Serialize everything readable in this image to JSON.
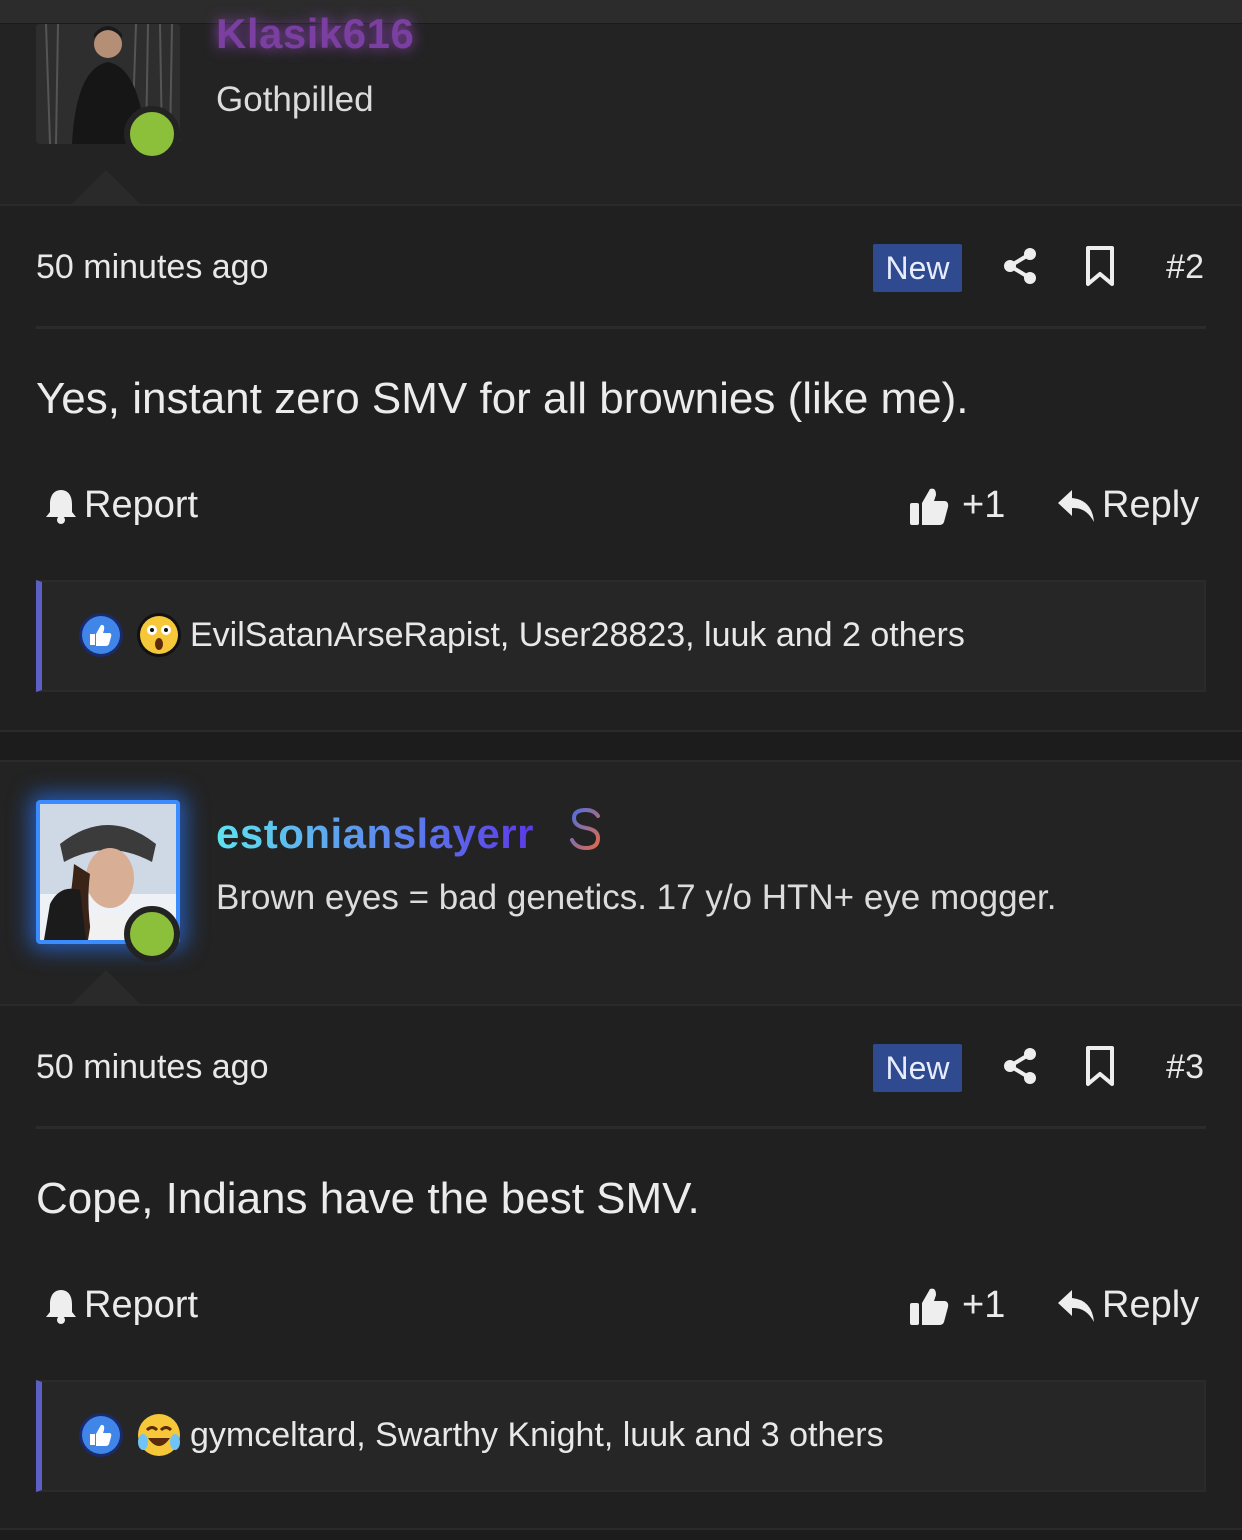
{
  "posts": [
    {
      "username": "Klasik616",
      "user_title": "Gothpilled",
      "username_color": "#7a3fa0",
      "time": "50 minutes ago",
      "badge": "New",
      "post_number": "#2",
      "message": "Yes, instant zero SMV for all brownies (like me).",
      "report_label": "Report",
      "like_count": "+1",
      "reply_label": "Reply",
      "reactions": [
        "thumbs-up-reaction",
        "shocked-face-reaction"
      ],
      "reaction_text": "EvilSatanArseRapist, User28823, luuk and 2 others"
    },
    {
      "username": "estonianslayerr",
      "user_title": "Brown eyes = bad genetics. 17 y/o HTN+ eye mogger.",
      "username_gradient": [
        "#5fe3f0",
        "#5b3ae8"
      ],
      "time": "50 minutes ago",
      "badge": "New",
      "post_number": "#3",
      "message": "Cope, Indians have the best SMV.",
      "report_label": "Report",
      "like_count": "+1",
      "reply_label": "Reply",
      "reactions": [
        "thumbs-up-reaction",
        "crying-laughing-reaction"
      ],
      "reaction_text": "gymceltard, Swarthy Knight, luuk and 3 others"
    }
  ],
  "colors": {
    "background": "#232323",
    "new_badge": "#2f4a8f",
    "reaction_accent": "#5c5fc4",
    "online": "#8cbf3a"
  }
}
